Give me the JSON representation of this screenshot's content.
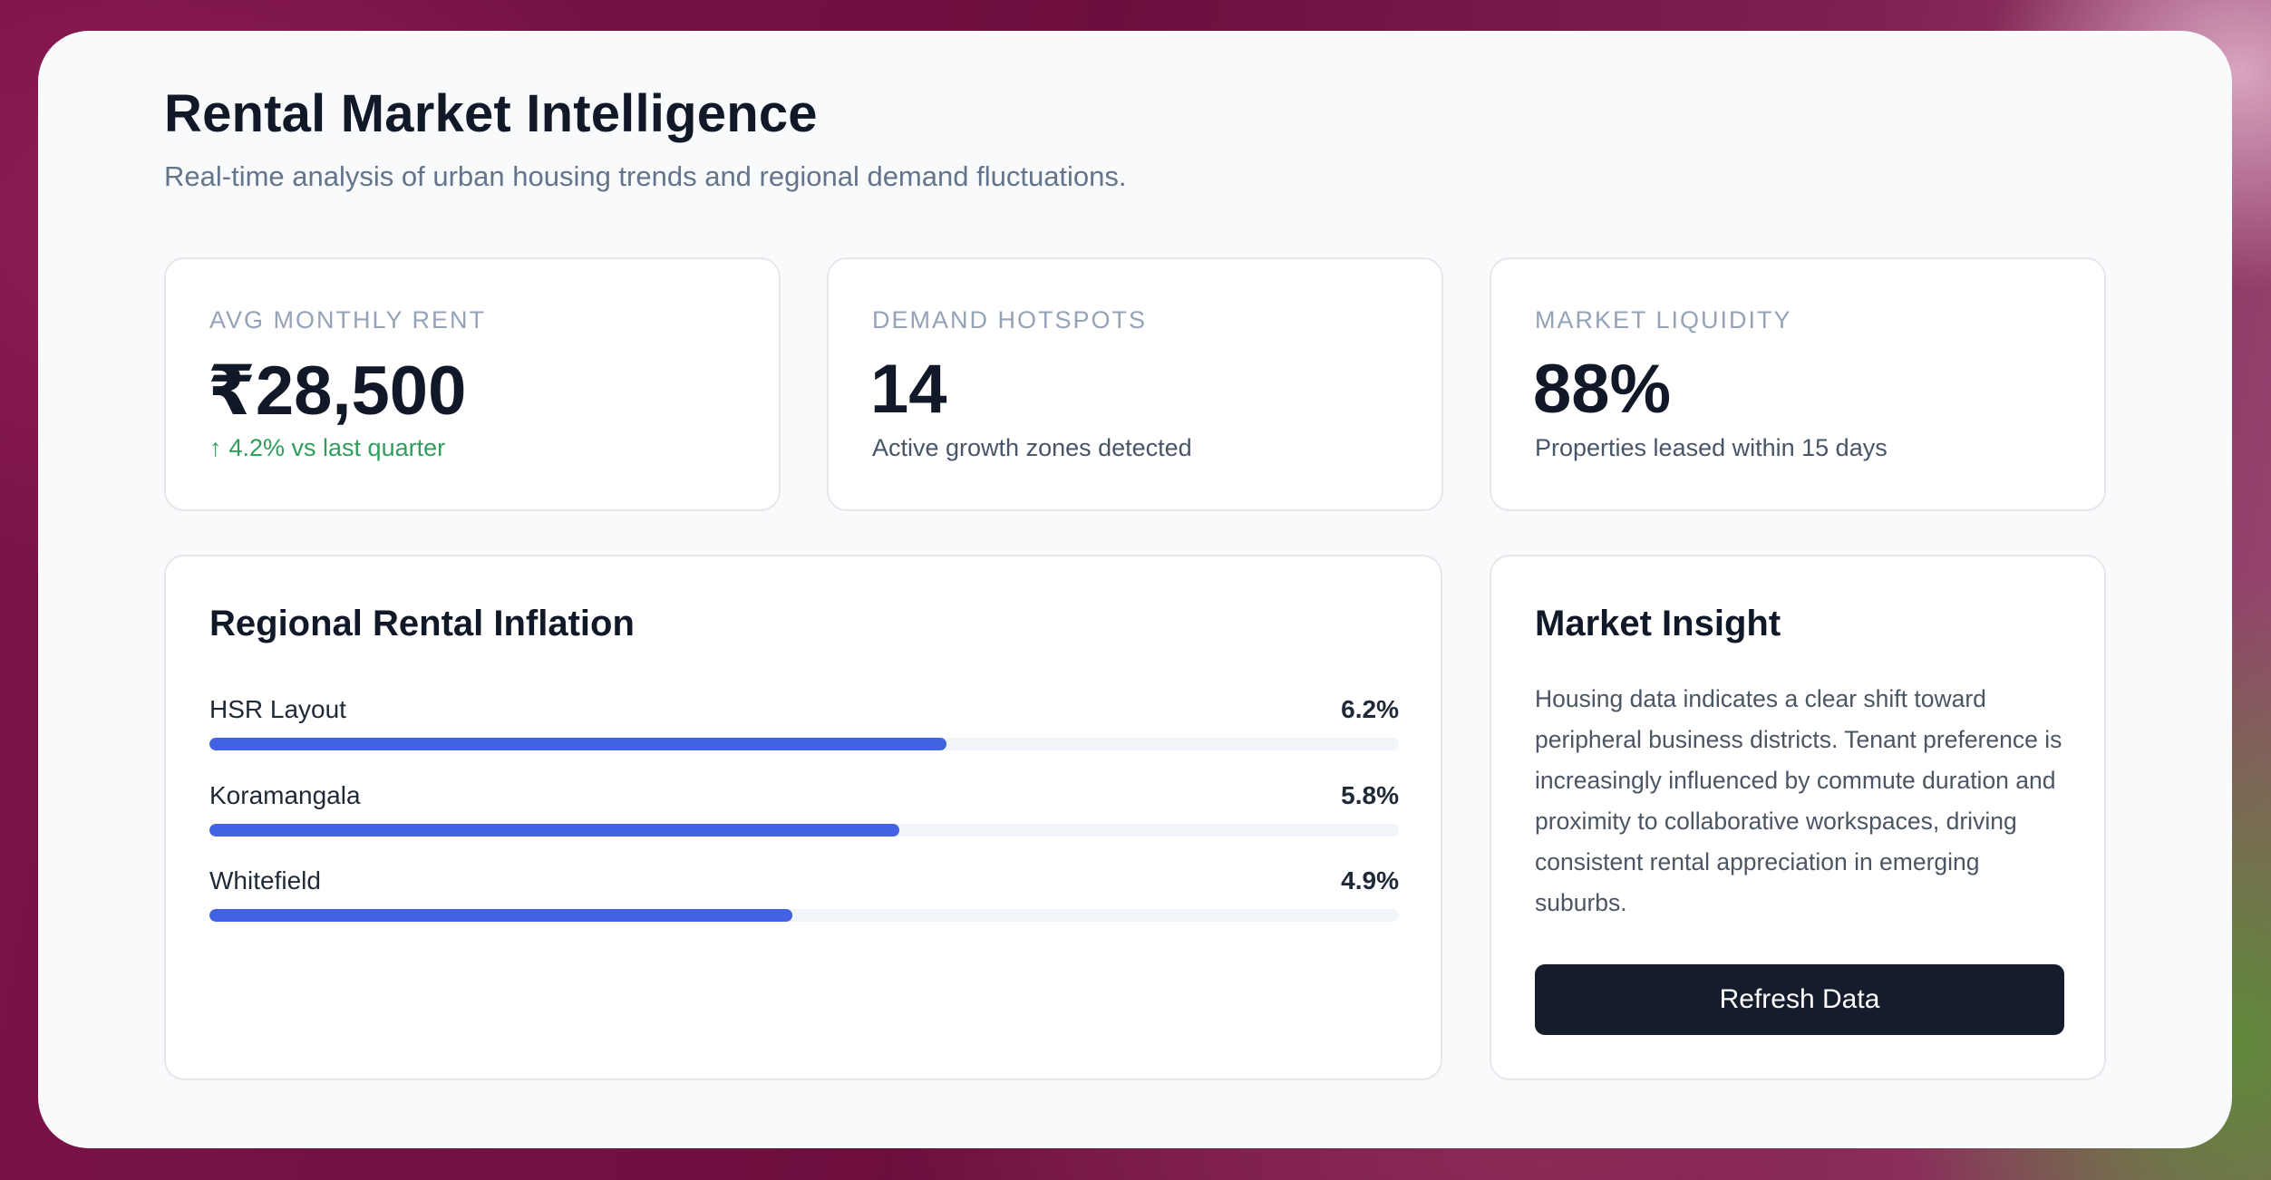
{
  "header": {
    "title": "Rental Market Intelligence",
    "subtitle": "Real-time analysis of urban housing trends and regional demand fluctuations."
  },
  "stats": [
    {
      "label": "AVG MONTHLY RENT",
      "value": "₹28,500",
      "note_icon": "arrow-up-icon",
      "note_arrow": "↑",
      "note": "4.2% vs last quarter",
      "note_color": "#2f9e5b"
    },
    {
      "label": "DEMAND HOTSPOTS",
      "value": "14",
      "note": "Active growth zones detected"
    },
    {
      "label": "MARKET LIQUIDITY",
      "value": "88%",
      "note": "Properties leased within 15 days"
    }
  ],
  "inflation": {
    "title": "Regional Rental Inflation",
    "bar_color": "#4361e3",
    "scale_max_percent": 10,
    "regions": [
      {
        "name": "HSR Layout",
        "value_label": "6.2%",
        "value": 6.2
      },
      {
        "name": "Koramangala",
        "value_label": "5.8%",
        "value": 5.8
      },
      {
        "name": "Whitefield",
        "value_label": "4.9%",
        "value": 4.9
      }
    ]
  },
  "insight": {
    "title": "Market Insight",
    "text": "Housing data indicates a clear shift toward peripheral business districts. Tenant preference is increasingly influenced by commute duration and proximity to collaborative workspaces, driving consistent rental appreciation in emerging suburbs.",
    "button_label": "Refresh Data"
  },
  "colors": {
    "panel_background": "#f8fafc",
    "button_background": "#151c2c",
    "positive": "#2f9e5b"
  }
}
